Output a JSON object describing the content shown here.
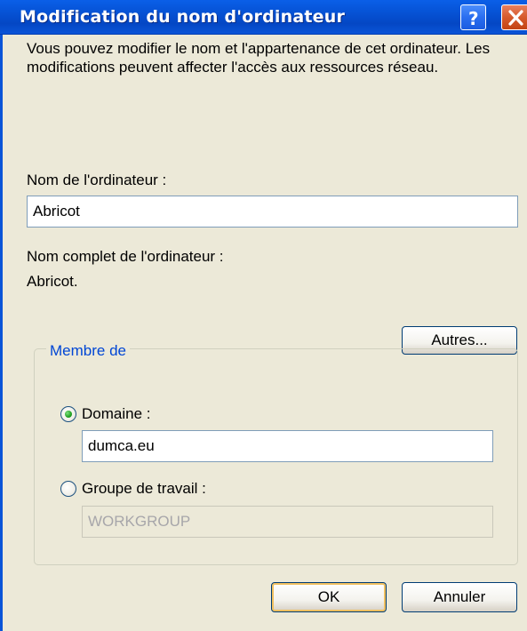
{
  "window": {
    "title": "Modification du nom d'ordinateur",
    "help_icon": "help-icon",
    "close_icon": "close-icon"
  },
  "intro_text": "Vous pouvez modifier le nom et l'appartenance de cet ordinateur. Les modifications peuvent affecter l'accès aux ressources réseau.",
  "computer_name": {
    "label": "Nom de l'ordinateur :",
    "value": "Abricot"
  },
  "full_name": {
    "label": "Nom complet de l'ordinateur :",
    "value": "Abricot."
  },
  "more_button": "Autres...",
  "member_of": {
    "legend": "Membre de",
    "domain": {
      "label": "Domaine :",
      "selected": true,
      "value": "dumca.eu"
    },
    "workgroup": {
      "label": "Groupe de travail :",
      "selected": false,
      "value": "WORKGROUP"
    }
  },
  "buttons": {
    "ok": "OK",
    "cancel": "Annuler"
  },
  "colors": {
    "titlebar": "#0653d6",
    "dialog_bg": "#ece9d8",
    "legend_text": "#0046d5",
    "close_button": "#d65a2c"
  }
}
